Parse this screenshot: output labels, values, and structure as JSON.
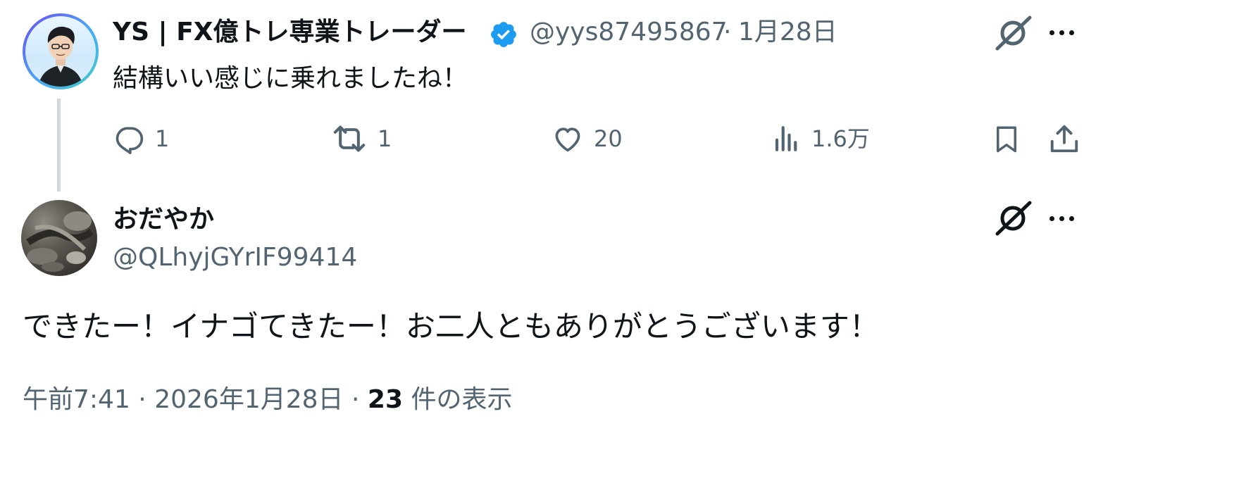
{
  "colors": {
    "accent": "#1d9bf0",
    "secondary": "#536471",
    "primary": "#0f1419",
    "thread_line": "#cfd9de"
  },
  "reply_tweet": {
    "display_name": "YS | FX億トレ専業トレーダー",
    "verified_icon": "verified-badge-icon",
    "handle": "@yys87495867",
    "separator": "·",
    "date": "1月28日",
    "text": "結構いい感じに乗れましたね！",
    "actions": {
      "replies": "1",
      "retweets": "1",
      "likes": "20",
      "views": "1.6万"
    }
  },
  "main_tweet": {
    "display_name": "おだやか",
    "handle": "@QLhyjGYrIF99414",
    "text": "できたー！イナゴてきたー！お二人ともありがとうございます！",
    "time": "午前7:41",
    "separator": "·",
    "date": "2026年1月28日",
    "view_count": "23",
    "view_label": "件の表示"
  }
}
